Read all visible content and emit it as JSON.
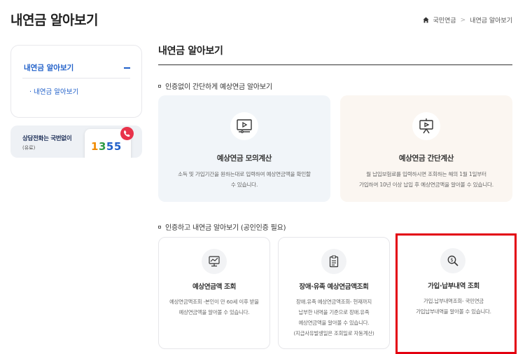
{
  "header": {
    "title": "내연금 알아보기",
    "breadcrumb": [
      "국민연금",
      "내연금 알아보기"
    ],
    "breadcrumb_sep": ">"
  },
  "sidebar": {
    "menu_label": "내연금 알아보기",
    "sub_items": [
      {
        "label": "· 내연금 알아보기"
      }
    ]
  },
  "call_banner": {
    "title": "상담전화는 국번없이",
    "sub": "(유료)",
    "number": [
      "1",
      "3",
      "5",
      "5"
    ]
  },
  "main": {
    "title": "내연금 알아보기",
    "section1": {
      "title": "인증없이 간단하게 예상연금 알아보기",
      "cards": [
        {
          "icon": "monitor-play-icon",
          "title": "예상연금 모의계산",
          "desc": [
            "소득 및 가입기간을 원하는대로 입력하여 예상연금액을 확인할",
            "수 있습니다."
          ]
        },
        {
          "icon": "presentation-play-icon",
          "title": "예상연금 간단계산",
          "desc": [
            "월 납입보험료를 입력하시면 조회하는 해의 1월 1일부터",
            "가입하여 10년 이상 납입 후 예상연금액을 알아볼 수 있습니다."
          ]
        }
      ]
    },
    "section2": {
      "title": "인증하고 내연금 알아보기 (공인인증 필요)",
      "cards": [
        {
          "icon": "monitor-chart-icon",
          "title": "예상연금액 조회",
          "desc": [
            "예상연금액조회 -본인이 만 60세 이후 받을",
            "예상연금액을 알아볼 수 있습니다."
          ]
        },
        {
          "icon": "clipboard-icon",
          "title": "장애·유족 예상연금액조회",
          "desc": [
            "장애.유족 예상연금액조회- 현재까지",
            "납부한 내역을 기준으로 장애.유족",
            "예상연금액을 알아볼 수 있습니다.",
            "(지급사유발생일은 조회일로 자동계산)"
          ]
        },
        {
          "icon": "search-coin-icon",
          "title": "가입·납부내역 조회",
          "desc": [
            "가입.납부내역조회- 국민연금",
            "가입납부내역을 알아볼 수 있습니다."
          ]
        }
      ]
    }
  },
  "colors": {
    "accent": "#1f5fc9",
    "highlight": "#e3000f",
    "badge": "#e8324a"
  }
}
